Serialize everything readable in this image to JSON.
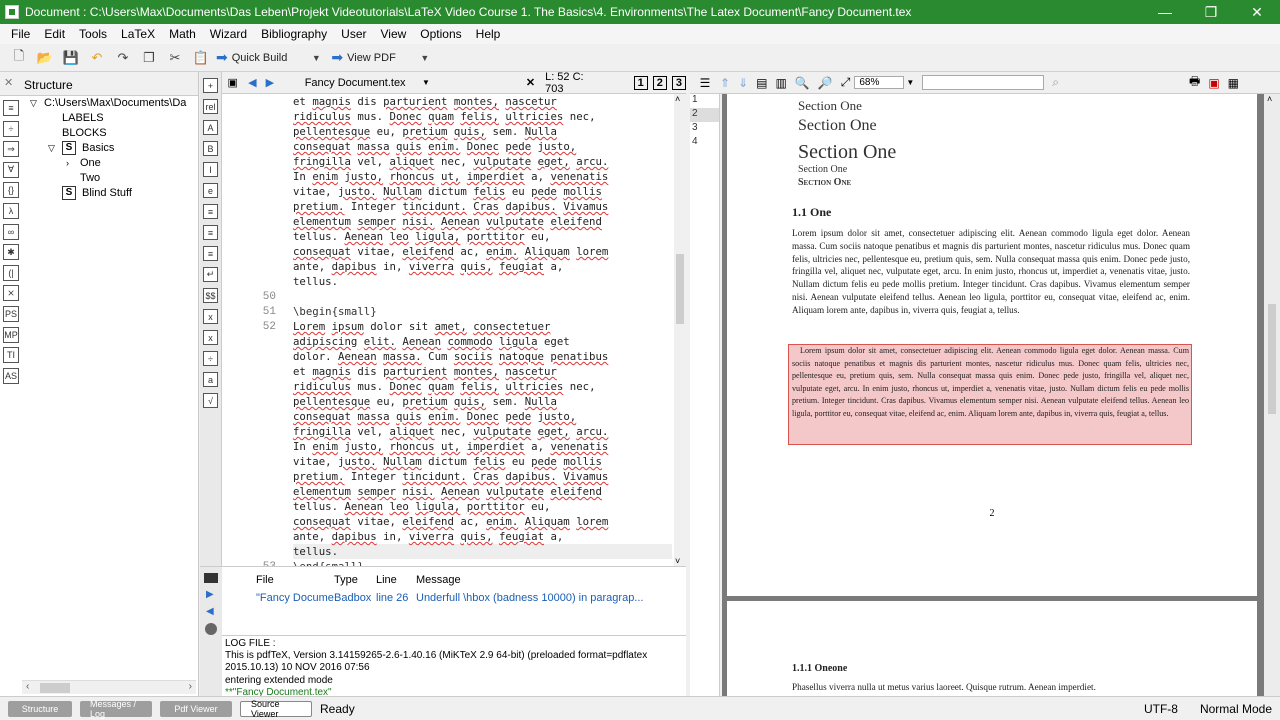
{
  "window": {
    "title": "Document : C:\\Users\\Max\\Documents\\Das Leben\\Projekt Videotutorials\\LaTeX Video Course 1. The Basics\\4. Environments\\The Latex Document\\Fancy Document.tex",
    "minimize": "—",
    "maximize": "❐",
    "close": "✕"
  },
  "menu": [
    "File",
    "Edit",
    "Tools",
    "LaTeX",
    "Math",
    "Wizard",
    "Bibliography",
    "User",
    "View",
    "Options",
    "Help"
  ],
  "toolbar": {
    "quick_build": "Quick Build",
    "view_pdf": "View PDF"
  },
  "structure": {
    "title": "Structure",
    "close": "✕",
    "items": [
      {
        "label": "C:\\Users\\Max\\Documents\\Da",
        "indent": 0,
        "expander": "▽"
      },
      {
        "label": "LABELS",
        "indent": 1
      },
      {
        "label": "BLOCKS",
        "indent": 1
      },
      {
        "label": "Basics",
        "indent": 1,
        "expander": "▽",
        "icon": "S"
      },
      {
        "label": "One",
        "indent": 2,
        "expander": "›"
      },
      {
        "label": "Two",
        "indent": 2
      },
      {
        "label": "Blind Stuff",
        "indent": 1,
        "icon": "S"
      }
    ],
    "left_icons": [
      "≡",
      "÷",
      "⇒",
      "∀",
      "{}",
      "λ",
      "∞",
      "✱",
      "(|",
      "⨯",
      "PS",
      "MP",
      "TI",
      "AS"
    ]
  },
  "editor": {
    "filename": "Fancy Document.tex",
    "position": "L: 52 C: 703",
    "views": [
      "1",
      "2",
      "3"
    ],
    "side_icons": [
      "+",
      "rel",
      "A",
      "B",
      "I",
      "e",
      "≡",
      "≡",
      "≡",
      "↵",
      "$$",
      "x",
      "x",
      "÷",
      "a",
      "√"
    ],
    "line_numbers": [
      {
        "n": "50",
        "row": 13
      },
      {
        "n": "51",
        "row": 14
      },
      {
        "n": "52",
        "row": 15
      },
      {
        "n": "53",
        "row": 31
      }
    ],
    "lines": [
      "et magnis dis parturient montes, nascetur",
      "ridiculus mus. Donec quam felis, ultricies nec,",
      "pellentesque eu, pretium quis, sem. Nulla",
      "consequat massa quis enim. Donec pede justo,",
      "fringilla vel, aliquet nec, vulputate eget, arcu.",
      "In enim justo, rhoncus ut, imperdiet a, venenatis",
      "vitae, justo. Nullam dictum felis eu pede mollis",
      "pretium. Integer tincidunt. Cras dapibus. Vivamus",
      "elementum semper nisi. Aenean vulputate eleifend",
      "tellus. Aenean leo ligula, porttitor eu,",
      "consequat vitae, eleifend ac, enim. Aliquam lorem",
      "ante, dapibus in, viverra quis, feugiat a,",
      "tellus.",
      "",
      "\\begin{small}",
      "Lorem ipsum dolor sit amet, consectetuer",
      "adipiscing elit. Aenean commodo ligula eget",
      "dolor. Aenean massa. Cum sociis natoque penatibus",
      "et magnis dis parturient montes, nascetur",
      "ridiculus mus. Donec quam felis, ultricies nec,",
      "pellentesque eu, pretium quis, sem. Nulla",
      "consequat massa quis enim. Donec pede justo,",
      "fringilla vel, aliquet nec, vulputate eget, arcu.",
      "In enim justo, rhoncus ut, imperdiet a, venenatis",
      "vitae, justo. Nullam dictum felis eu pede mollis",
      "pretium. Integer tincidunt. Cras dapibus. Vivamus",
      "elementum semper nisi. Aenean vulputate eleifend",
      "tellus. Aenean leo ligula, porttitor eu,",
      "consequat vitae, eleifend ac, enim. Aliquam lorem",
      "ante, dapibus in, viverra quis, feugiat a,",
      "tellus.",
      "\\end{small}"
    ]
  },
  "messages": {
    "headers": [
      "File",
      "Type",
      "Line",
      "Message"
    ],
    "rows": [
      [
        "\"Fancy Document.tex",
        "Badbox",
        "line 26",
        "Underfull \\hbox (badness 10000) in paragrap..."
      ]
    ],
    "log_lines": [
      "LOG FILE :",
      "This is pdfTeX, Version 3.14159265-2.6-1.40.16 (MiKTeX 2.9 64-bit) (preloaded format=pdflatex",
      "2015.10.13) 10 NOV 2016 07:56",
      "entering extended mode",
      "**\"Fancy Document.tex\""
    ]
  },
  "pdf": {
    "zoom": "68%",
    "search_placeholder": "",
    "thumbs": [
      "1",
      "2",
      "3",
      "4"
    ],
    "section_lines": [
      "Section One",
      "Section One",
      "Section One",
      "Section One",
      "Section One"
    ],
    "subsection": "1.1  One",
    "para1": "Lorem ipsum dolor sit amet, consectetuer adipiscing elit. Aenean commodo ligula eget dolor. Aenean massa. Cum sociis natoque penatibus et magnis dis parturient montes, nascetur ridiculus mus. Donec quam felis, ultricies nec, pellentesque eu, pretium quis, sem. Nulla consequat massa quis enim. Donec pede justo, fringilla vel, aliquet nec, vulputate eget, arcu. In enim justo, rhoncus ut, imperdiet a, venenatis vitae, justo. Nullam dictum felis eu pede mollis pretium. Integer tincidunt. Cras dapibus. Vivamus elementum semper nisi. Aenean vulputate eleifend tellus. Aenean leo ligula, porttitor eu, consequat vitae, eleifend ac, enim. Aliquam lorem ante, dapibus in, viverra quis, feugiat a, tellus.",
    "para2": "Lorem ipsum dolor sit amet, consectetuer adipiscing elit. Aenean commodo ligula eget dolor. Aenean massa. Cum sociis natoque penatibus et magnis dis parturient montes, nascetur ridiculus mus. Donec quam felis, ultricies nec, pellentesque eu, pretium quis, sem. Nulla consequat massa quis enim. Donec pede justo, fringilla vel, aliquet nec, vulputate eget, arcu. In enim justo, rhoncus ut, imperdiet a, venenatis vitae, justo. Nullam dictum felis eu pede mollis pretium. Integer tincidunt. Cras dapibus. Vivamus elementum semper nisi. Aenean vulputate eleifend tellus. Aenean leo ligula, porttitor eu, consequat vitae, eleifend ac, enim. Aliquam lorem ante, dapibus in, viverra quis, feugiat a, tellus.",
    "page_number": "2",
    "page2_heading": "1.1.1  Oneone",
    "page2_text": "Phasellus viverra nulla ut metus varius laoreet. Quisque rutrum. Aenean imperdiet."
  },
  "status": {
    "tabs": [
      "Structure",
      "Messages / Log",
      "Pdf Viewer",
      "Source Viewer"
    ],
    "active_tab": 3,
    "ready": "Ready",
    "encoding": "UTF-8",
    "mode": "Normal Mode"
  },
  "colors": {
    "titlebar": "#2a8a2f",
    "highlight_fill": "#f4c7c9",
    "highlight_border": "#d9534f",
    "link": "#1a5fb4"
  }
}
